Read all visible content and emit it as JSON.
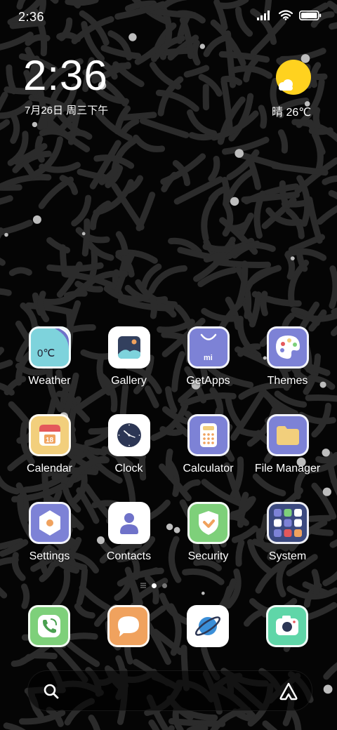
{
  "status_bar": {
    "time": "2:36",
    "icons": [
      "signal-icon",
      "wifi-icon",
      "battery-icon"
    ]
  },
  "clock_widget": {
    "time": "2:36",
    "date": "7月26日 周三下午",
    "weather": "晴 26℃"
  },
  "apps": [
    {
      "label": "Weather",
      "icon": "weather-icon",
      "color": "#7ed3dc",
      "badge": "0℃"
    },
    {
      "label": "Gallery",
      "icon": "gallery-icon",
      "color": "#ffffff"
    },
    {
      "label": "GetApps",
      "icon": "getapps-icon",
      "color": "#7d82d6",
      "badge": "mi"
    },
    {
      "label": "Themes",
      "icon": "themes-icon",
      "color": "#7d82d6"
    },
    {
      "label": "Calendar",
      "icon": "calendar-icon",
      "color": "#f2cf7c",
      "badge": "18"
    },
    {
      "label": "Clock",
      "icon": "clock-icon",
      "color": "#ffffff"
    },
    {
      "label": "Calculator",
      "icon": "calculator-icon",
      "color": "#7d82d6"
    },
    {
      "label": "File Manager",
      "icon": "folder-icon",
      "color": "#7d82d6"
    },
    {
      "label": "Settings",
      "icon": "settings-icon",
      "color": "#7d82d6"
    },
    {
      "label": "Contacts",
      "icon": "contacts-icon",
      "color": "#ffffff"
    },
    {
      "label": "Security",
      "icon": "security-icon",
      "color": "#7ed07a"
    },
    {
      "label": "System",
      "icon": "system-folder-icon",
      "color": "#3c4a80"
    }
  ],
  "page_indicator": {
    "pages": 3,
    "current": 2
  },
  "dock": [
    {
      "icon": "phone-icon",
      "color": "#7ed07a"
    },
    {
      "icon": "messages-icon",
      "color": "#f0a25e"
    },
    {
      "icon": "browser-icon",
      "color": "#ffffff"
    },
    {
      "icon": "camera-icon",
      "color": "#5fd6a8"
    }
  ],
  "search_bar": {
    "left_icon": "search-icon",
    "right_icon": "assistant-icon"
  },
  "colors": {
    "background": "#050505",
    "pattern": "#2b2b2b",
    "accent_sun": "#ffd21f"
  }
}
